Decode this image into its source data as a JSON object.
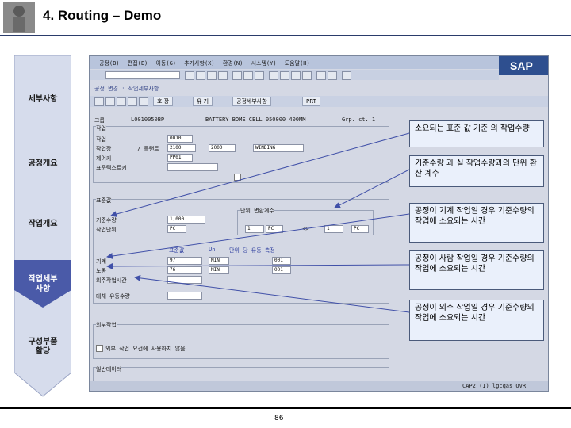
{
  "slide": {
    "title": "4. Routing – Demo",
    "page_number": "86"
  },
  "sidebar": {
    "items": [
      {
        "label": "세부사항"
      },
      {
        "label": "공정개요"
      },
      {
        "label": "작업개요"
      },
      {
        "label": "작업세부\n사항"
      },
      {
        "label": "구성부품\n할당"
      }
    ]
  },
  "sap": {
    "menu": [
      "공정(B)",
      "편집(E)",
      "이동(G)",
      "추가사항(X)",
      "환경(N)",
      "시스템(Y)",
      "도움말(H)"
    ],
    "screen_title": "공정 변경 : 작업세부사항",
    "tabs": [
      "호 장",
      "유 거",
      "공정세부사항",
      "PRT"
    ],
    "header_label": "그룹",
    "header_code": "L0010050BP",
    "header_desc": "BATTERY BOME CELL 050000 400MM",
    "header_counter": "Grp. ct. 1",
    "section_op": "작업",
    "fields": {
      "op_label": "작업",
      "op_value": "0010",
      "workcenter_label": "작업장",
      "workcenter_value": "2100",
      "plant_label": "/ 플랜트",
      "plant_value": "2000",
      "desc_value": "WINDING",
      "control_label": "제어키",
      "control_value": "PP01",
      "std_text_label": "표준텍스트키"
    },
    "section_std": "표준값",
    "std_headers": [
      "기준수량",
      "작업단위"
    ],
    "std_values": {
      "base_qty": "1,000",
      "base_unit": "PC"
    },
    "conversion": {
      "title": "단위 변환계수",
      "left_qty": "1",
      "left_unit": "PC",
      "right_qty": "1",
      "right_unit": "PC",
      "arrow": "<>"
    },
    "std_table_header": [
      "표준값",
      "Un",
      "단위 당 유동 측정"
    ],
    "std_rows": [
      {
        "label": "기계",
        "value": "97",
        "unit": "MIN",
        "key": "001"
      },
      {
        "label": "노동",
        "value": "76",
        "unit": "MIN",
        "key": "001"
      },
      {
        "label": "외주작업시간",
        "value": "",
        "unit": "",
        "key": ""
      },
      {
        "label": "대체 유동수량",
        "value": "",
        "unit": "",
        "key": ""
      }
    ],
    "section_ext": "외부작업",
    "ext_checkbox": "외부 작업 요건에 사용하지 않음",
    "section_general": "일반데이터",
    "status_bar": "CAP2 (1) lgcqas  OVR"
  },
  "annotations": [
    {
      "text": "소요되는 표준 값 기준 의 작업수량"
    },
    {
      "text": "기준수량 과 실 작업수량과의 단위 환산 계수"
    },
    {
      "text": "공정이 기계 작업일 경우 기준수량의 작업에 소요되는 시간"
    },
    {
      "text": "공정이 사람 작업일 경우 기준수량의 작업에 소요되는 시간"
    },
    {
      "text": "공정이 외주 작업일 경우 기준수량의 작업에 소요되는 시간"
    }
  ],
  "colors": {
    "sidebar_arrow": "#d6dcec",
    "sidebar_active": "#4a5aa8",
    "arrow_line": "#4050a8",
    "sap_bg": "#d4d8e4"
  }
}
